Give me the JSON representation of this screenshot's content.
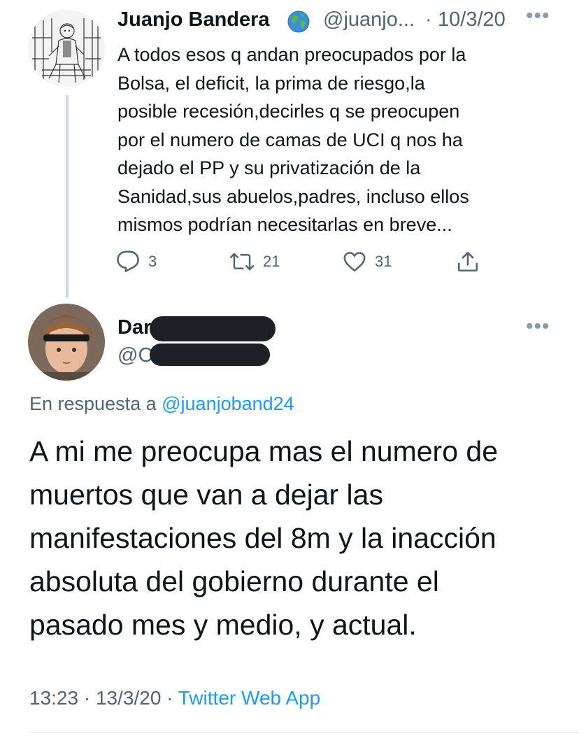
{
  "parent_tweet": {
    "author_name": "Juanjo Bandera",
    "author_badge_icon": "globe-emoji-icon",
    "handle": "@juanjo...",
    "separator": "·",
    "date": "10/3/20",
    "more_icon": "•••",
    "text_lines": [
      "A todos esos q andan preocupados por la",
      "Bolsa, el deficit, la prima de riesgo,la",
      "posible recesión,decirles q se preocupen",
      "por el numero de camas de UCI q nos ha",
      "dejado el PP y su privatización de la",
      "Sanidad,sus abuelos,padres, incluso ellos",
      "mismos podrían necesitarlas en breve..."
    ],
    "actions": {
      "replies": "3",
      "retweets": "21",
      "likes": "31"
    }
  },
  "reply_tweet": {
    "author_name_visible": "Dar",
    "handle_visible": "@C",
    "more_icon": "•••",
    "in_reply_to_prefix": "En respuesta a ",
    "in_reply_to_handle": "@juanjoband24",
    "text_lines": [
      "A mi me preocupa mas el numero de",
      "muertos que van a dejar las",
      "manifestaciones del 8m y la inacción",
      "absoluta del gobierno durante el",
      "pasado mes y medio, y actual."
    ],
    "time": "13:23",
    "date": "13/3/20",
    "separator": "·",
    "source": "Twitter Web App"
  },
  "colors": {
    "text": "#0f1419",
    "secondary": "#536471",
    "link": "#1d9bf0",
    "thread_line": "#cfd9de",
    "redaction": "#1d2126"
  }
}
